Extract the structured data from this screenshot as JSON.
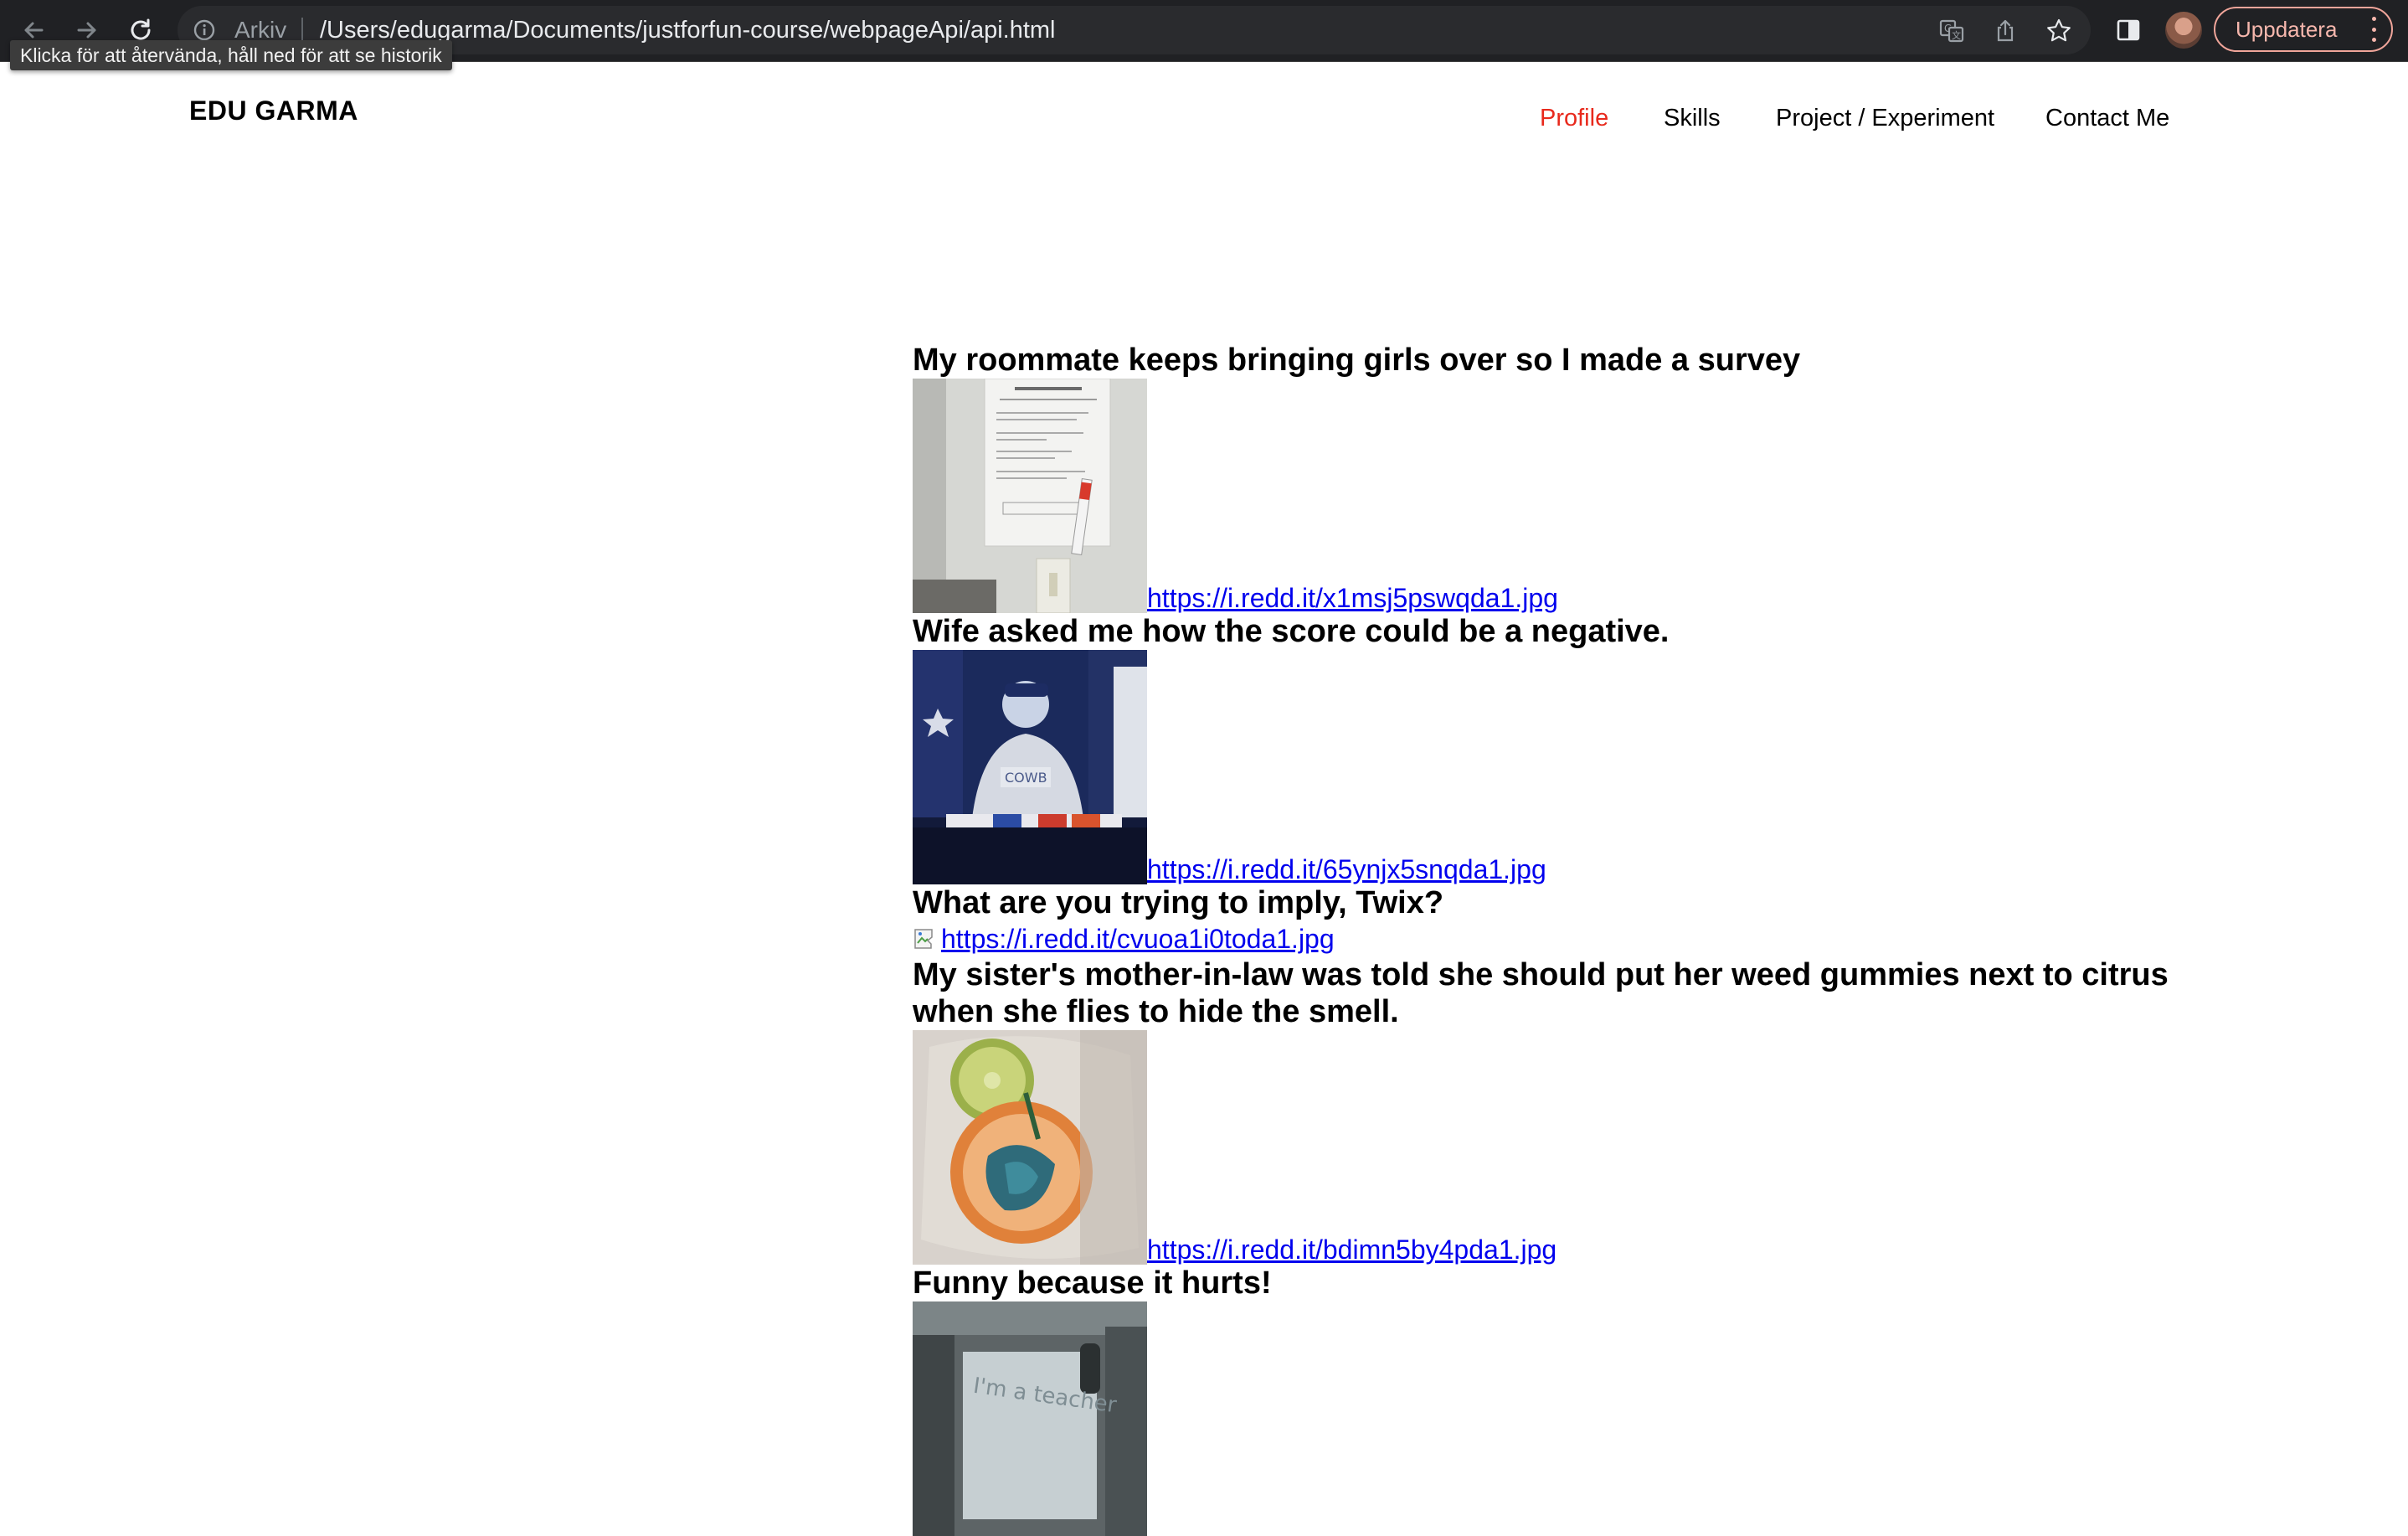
{
  "browser": {
    "omnibox": {
      "chip_label": "Arkiv",
      "url": "/Users/edugarma/Documents/justforfun-course/webpageApi/api.html"
    },
    "back_tooltip": "Klicka för att återvända, håll ned för att se historik",
    "update_button_label": "Uppdatera",
    "icons": [
      "back-arrow-icon",
      "forward-arrow-icon",
      "reload-icon",
      "info-icon",
      "translate-icon",
      "share-icon",
      "star-icon",
      "sidepanel-icon",
      "more-vert-icon"
    ]
  },
  "site": {
    "brand": "EDU GARMA",
    "nav": [
      {
        "label": "Profile",
        "active": true
      },
      {
        "label": "Skills",
        "active": false
      },
      {
        "label": "Project / Experiment",
        "active": false
      },
      {
        "label": "Contact Me",
        "active": false
      }
    ],
    "active_color": "#e8291c",
    "link_color": "#0000ee"
  },
  "posts": [
    {
      "title": "My roommate keeps bringing girls over so I made a survey",
      "url": "https://i.redd.it/x1msj5pswqda1.jpg",
      "image": "survey-photo"
    },
    {
      "title": "Wife asked me how the score could be a negative.",
      "url": "https://i.redd.it/65ynjx5snqda1.jpg",
      "image": "tv-football-photo"
    },
    {
      "title": "What are you trying to imply, Twix?",
      "url": "https://i.redd.it/cvuoa1i0toda1.jpg",
      "image": "broken-image"
    },
    {
      "title": "My sister's mother-in-law was told she should put her weed gummies next to citrus when she flies to hide the smell.",
      "url": "https://i.redd.it/bdimn5by4pda1.jpg",
      "image": "citrus-photo"
    },
    {
      "title": "Funny because it hurts!",
      "url": "",
      "image": "teacher-sign-photo",
      "image_text": "I'm a teacher"
    }
  ]
}
